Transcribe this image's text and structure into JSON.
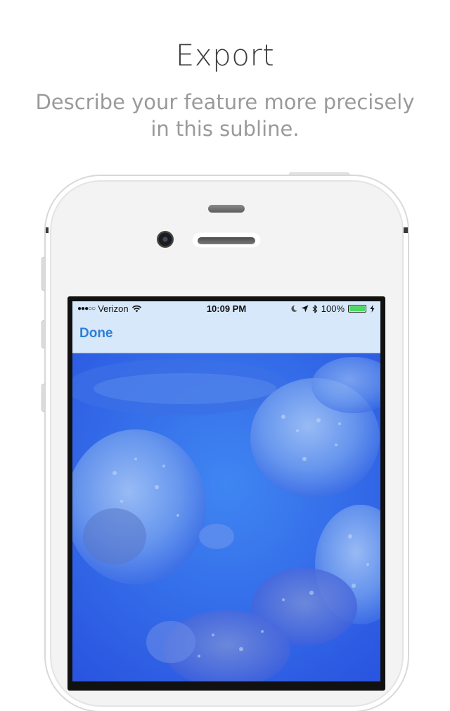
{
  "header": {
    "title": "Export",
    "subline": "Describe your feature more precisely in this subline."
  },
  "status_bar": {
    "signal": "●●●○○",
    "carrier": "Verizon",
    "time": "10:09 PM",
    "battery": "100%",
    "battery_level": 1.0
  },
  "nav": {
    "done_label": "Done"
  },
  "photo": {
    "subject": "jellyfish underwater"
  },
  "colors": {
    "accent": "#2d7fd6",
    "bar_background": "#d7e8fb",
    "photo_water": "#2f6cf0",
    "battery_green": "#4cd964"
  },
  "icons": [
    "wifi-icon",
    "moon-icon",
    "location-arrow-icon",
    "bluetooth-icon",
    "battery-icon",
    "charging-bolt-icon"
  ]
}
